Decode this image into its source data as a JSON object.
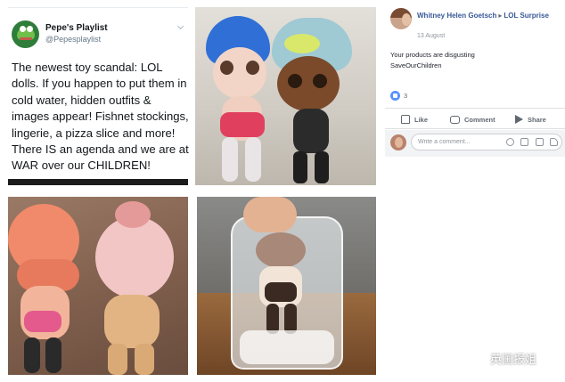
{
  "tweet": {
    "display_name": "Pepe's Playlist",
    "handle": "@Pepesplaylist",
    "text": "The newest toy scandal: LOL dolls. If you happen to put them in cold water, hidden outfits & images appear! Fishnet stockings, lingerie, a pizza slice and more! There IS an agenda and we are at WAR over our CHILDREN!"
  },
  "facebook_post": {
    "author": "Whitney Helen Goetsch",
    "target": "LOL Surprise",
    "date": "13 August",
    "body_line1": "Your products are disgusting",
    "body_line2": "SaveOurChildren",
    "reaction_count": "3",
    "actions": {
      "like": "Like",
      "comment": "Comment",
      "share": "Share"
    },
    "comment_placeholder": "Write a comment..."
  },
  "watermark": {
    "text": "英国报姐"
  },
  "colors": {
    "fb_link": "#385898",
    "twitter_text": "#14171a",
    "fb_like": "#5890ff"
  },
  "icons": [
    "pepe-frog-avatar",
    "chevron-down-icon",
    "like-reaction-icon",
    "thumbs-up-icon",
    "comment-icon",
    "share-icon",
    "emoji-icon",
    "camera-icon",
    "gif-icon",
    "sticker-icon",
    "wechat-icon"
  ]
}
